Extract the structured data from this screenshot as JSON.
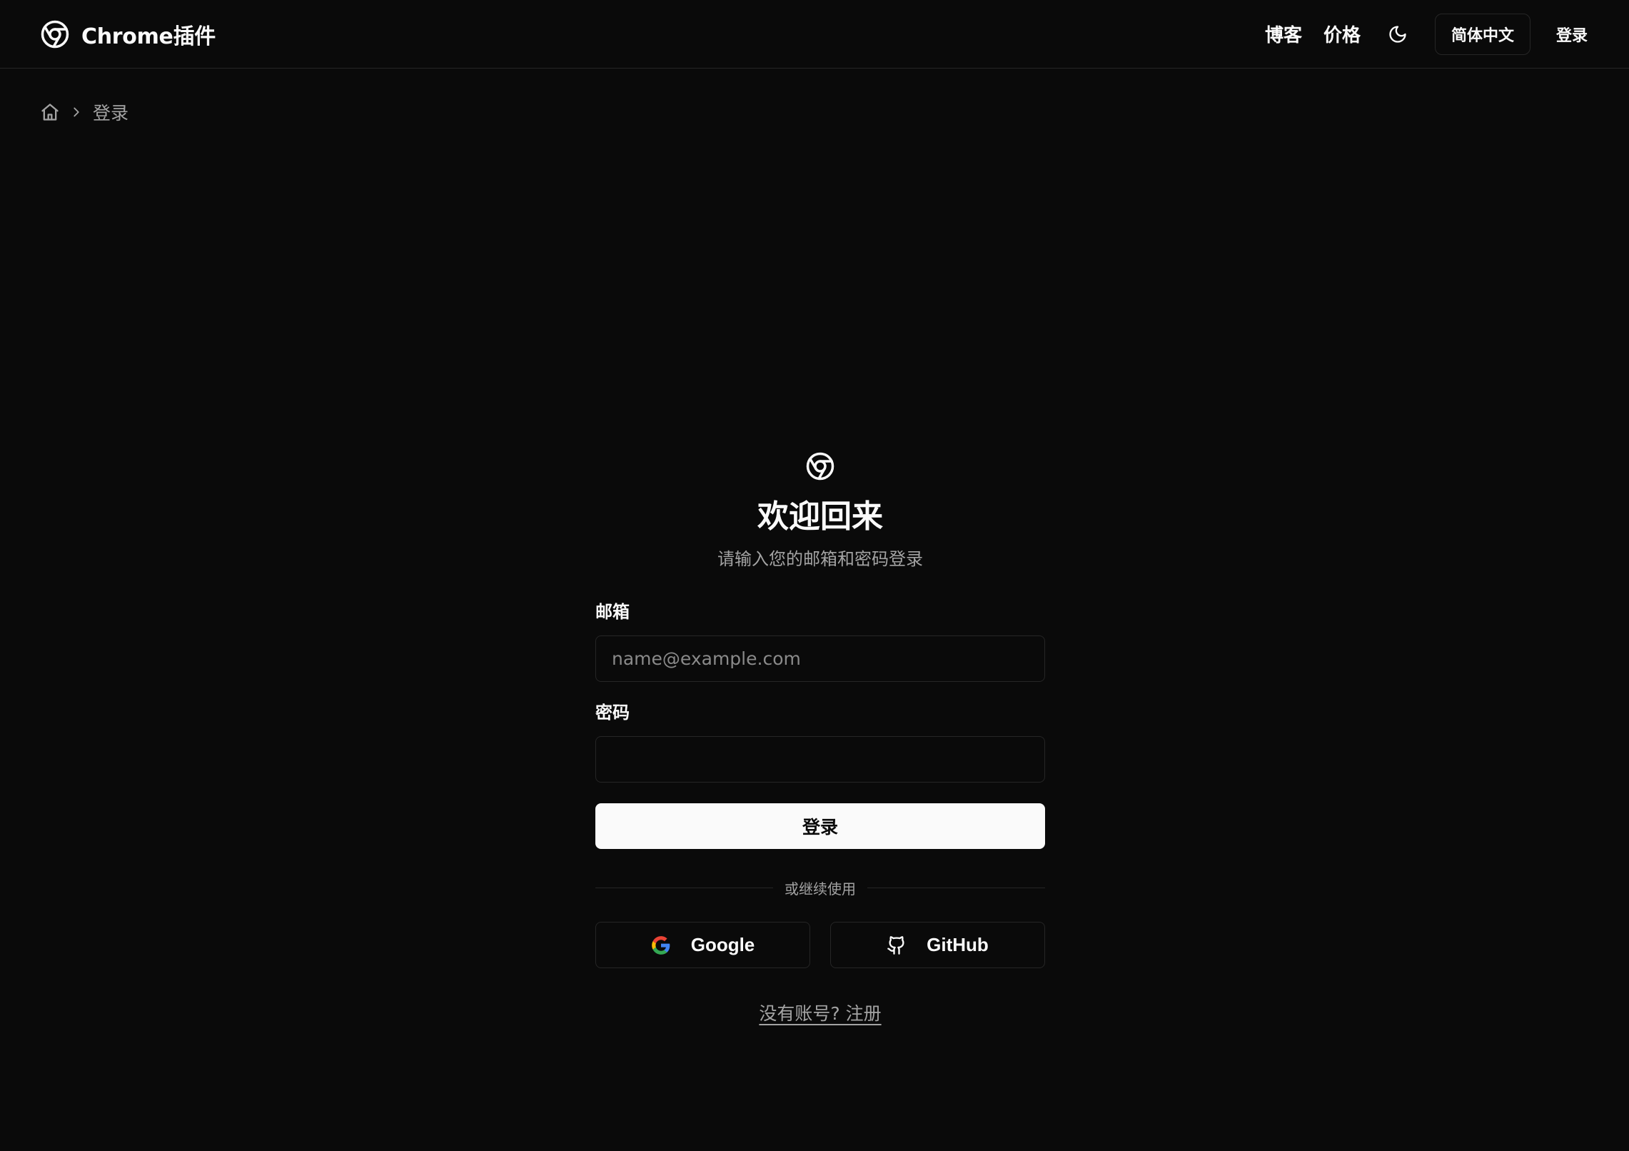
{
  "header": {
    "brand_name": "Chrome插件",
    "nav": {
      "blog": "博客",
      "pricing": "价格"
    },
    "language": "简体中文",
    "login": "登录"
  },
  "breadcrumb": {
    "current": "登录"
  },
  "auth": {
    "title": "欢迎回来",
    "subtitle": "请输入您的邮箱和密码登录",
    "email_label": "邮箱",
    "email_placeholder": "name@example.com",
    "email_value": "",
    "password_label": "密码",
    "password_value": "",
    "submit_label": "登录",
    "divider_text": "或继续使用",
    "google_label": "Google",
    "github_label": "GitHub",
    "signup_text": "没有账号? 注册"
  },
  "icons": {
    "brand": "chrome-icon",
    "theme": "moon-icon",
    "home": "home-icon",
    "separator": "chevron-right-icon",
    "google": "google-icon",
    "github": "github-icon"
  },
  "colors": {
    "background": "#0a0a0a",
    "foreground": "#fafafa",
    "muted": "#a3a3a3",
    "border": "#262626",
    "primary_button_bg": "#fafafa",
    "primary_button_text": "#0a0a0a"
  }
}
